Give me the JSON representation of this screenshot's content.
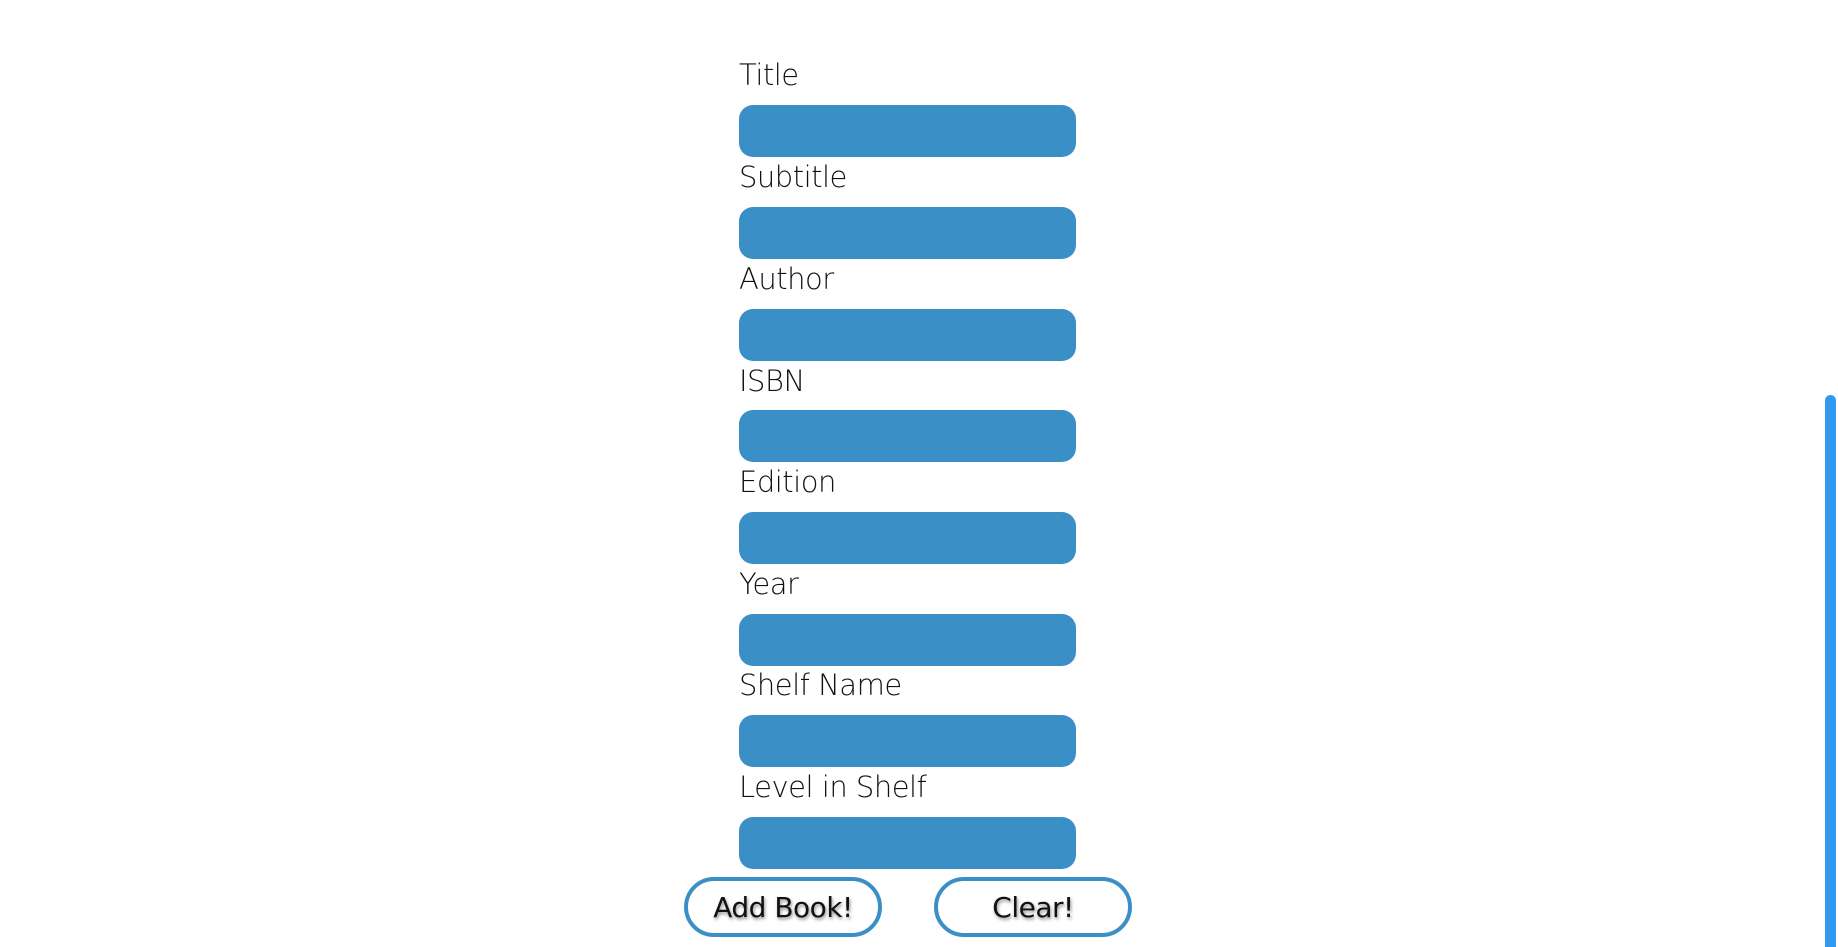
{
  "form": {
    "fields": [
      {
        "key": "title",
        "label": "Title",
        "value": ""
      },
      {
        "key": "subtitle",
        "label": "Subtitle",
        "value": ""
      },
      {
        "key": "author",
        "label": "Author",
        "value": ""
      },
      {
        "key": "isbn",
        "label": "ISBN",
        "value": ""
      },
      {
        "key": "edition",
        "label": "Edition",
        "value": ""
      },
      {
        "key": "year",
        "label": "Year",
        "value": ""
      },
      {
        "key": "shelf_name",
        "label": "Shelf Name",
        "value": ""
      },
      {
        "key": "level_in_shelf",
        "label": "Level in Shelf",
        "value": ""
      }
    ],
    "buttons": {
      "add_label": "Add Book!",
      "clear_label": "Clear!"
    }
  },
  "colors": {
    "input_fill": "#3b8fc7",
    "button_border": "#3b8fc7",
    "scrollbar": "#2f9af0"
  }
}
